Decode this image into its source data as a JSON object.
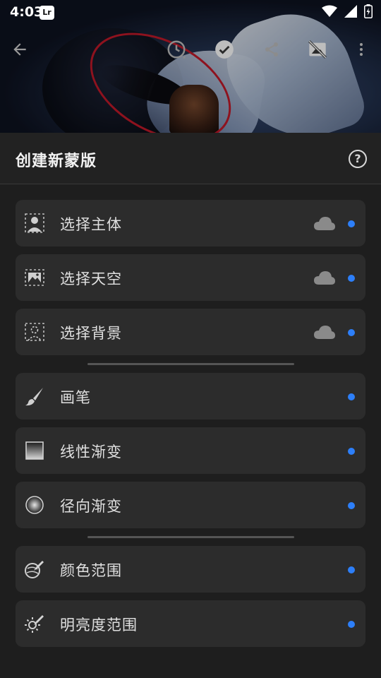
{
  "status_bar": {
    "time": "4:03",
    "app_badge": "Lr",
    "icons": [
      "wifi-icon",
      "signal-icon",
      "battery-charging-icon"
    ]
  },
  "toolbar": {
    "icons": [
      "back-arrow-icon",
      "history-icon",
      "check-icon",
      "share-icon",
      "hide-overlay-icon",
      "more-vert-icon"
    ]
  },
  "sheet": {
    "title": "创建新蒙版",
    "help_icon": "help-circle-icon",
    "accent": "#2d7ff9",
    "groups": [
      {
        "items": [
          {
            "label": "选择主体",
            "icon": "select-subject-icon",
            "cloud": true
          },
          {
            "label": "选择天空",
            "icon": "select-sky-icon",
            "cloud": true
          },
          {
            "label": "选择背景",
            "icon": "select-background-icon",
            "cloud": true
          }
        ]
      },
      {
        "items": [
          {
            "label": "画笔",
            "icon": "brush-icon",
            "cloud": false
          },
          {
            "label": "线性渐变",
            "icon": "linear-gradient-icon",
            "cloud": false
          },
          {
            "label": "径向渐变",
            "icon": "radial-gradient-icon",
            "cloud": false
          }
        ]
      },
      {
        "items": [
          {
            "label": "颜色范围",
            "icon": "color-range-icon",
            "cloud": false
          },
          {
            "label": "明亮度范围",
            "icon": "luminance-range-icon",
            "cloud": false
          }
        ]
      }
    ]
  }
}
